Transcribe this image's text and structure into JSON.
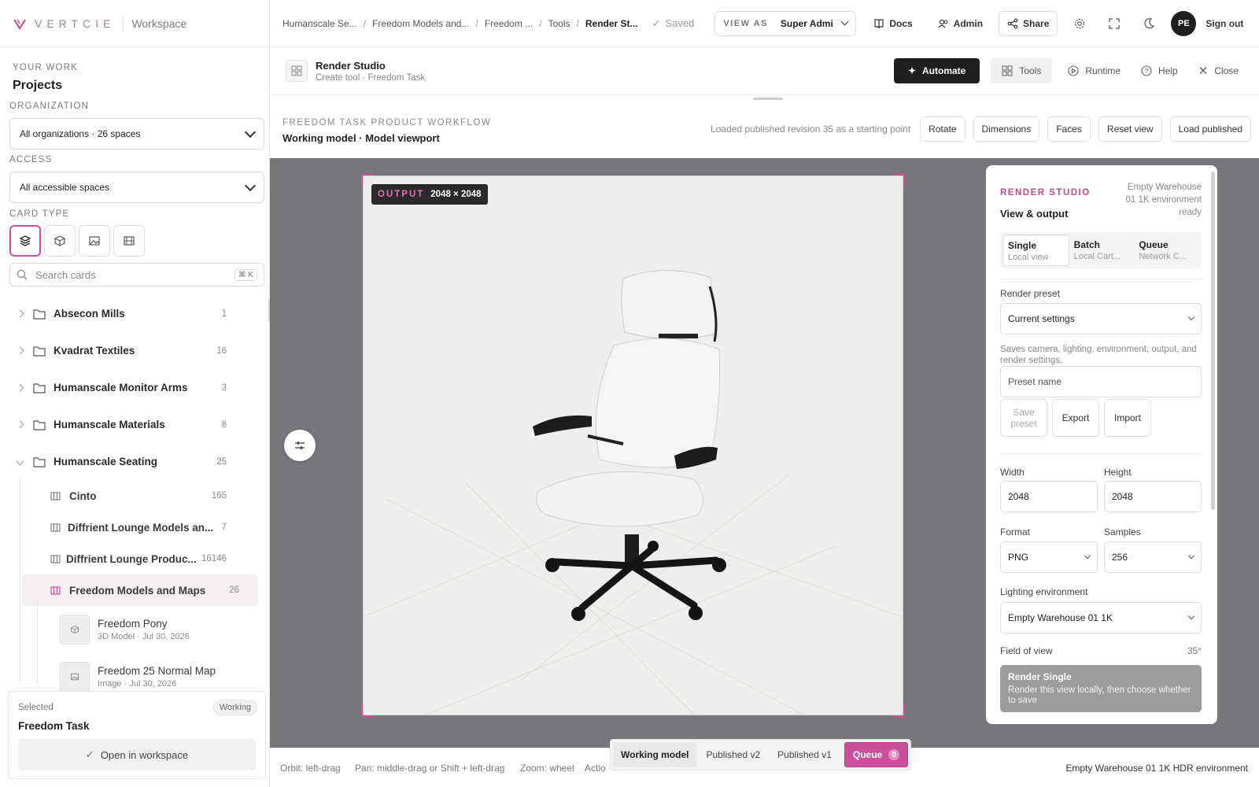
{
  "brand": {
    "logo_text": "VERTCIE",
    "workspace": "Workspace"
  },
  "sidebar": {
    "your_work": "YOUR WORK",
    "title": "Projects",
    "org_label": "ORGANIZATION",
    "org_value": "All organizations · 26 spaces",
    "access_label": "ACCESS",
    "access_value": "All accessible spaces",
    "card_type_label": "CARD TYPE",
    "card_types": [
      "layers-icon",
      "cube-icon",
      "image-icon",
      "film-icon"
    ],
    "search_placeholder": "Search cards",
    "search_shortcut": "⌘ K",
    "folders": [
      {
        "name": "Absecon Mills",
        "count": "1"
      },
      {
        "name": "Kvadrat Textiles",
        "count": "16"
      },
      {
        "name": "Humanscale Monitor Arms",
        "count": "3"
      },
      {
        "name": "Humanscale Materials",
        "count": "8"
      },
      {
        "name": "Humanscale Seating",
        "count": "25"
      }
    ],
    "subfolders": [
      {
        "name": "Cinto",
        "count": "165"
      },
      {
        "name": "Diffrient Lounge Models an...",
        "count": "7"
      },
      {
        "name": "Diffrient Lounge Produc...",
        "count": "16146"
      },
      {
        "name": "Freedom Models and Maps",
        "count": "26"
      }
    ],
    "items": [
      {
        "name": "Freedom Pony",
        "meta": "3D Model · Jul 30, 2026"
      },
      {
        "name": "Freedom 25 Normal Map",
        "meta": "Image · Jul 30, 2026"
      }
    ],
    "selected": {
      "label": "Selected",
      "badge": "Working",
      "name": "Freedom Task",
      "open_label": "Open in workspace"
    }
  },
  "topbar": {
    "breadcrumbs": [
      "Humanscale Se...",
      "Freedom Models and...",
      "Freedom ...",
      "Tools",
      "Render St..."
    ],
    "saved": "Saved",
    "view_as_label": "VIEW AS",
    "view_as_value": "Super Admi",
    "docs": "Docs",
    "admin": "Admin",
    "share": "Share",
    "avatar": "PE",
    "sign_out": "Sign out"
  },
  "tool": {
    "name": "Render Studio",
    "sub": "Create tool · Freedom Task",
    "automate": "Automate",
    "tools": "Tools",
    "runtime": "Runtime",
    "help": "Help",
    "close": "Close"
  },
  "workflow": {
    "kicker": "FREEDOM TASK PRODUCT WORKFLOW",
    "title": "Working model · Model viewport",
    "note": "Loaded published revision 35 as a starting point",
    "buttons": [
      "Rotate",
      "Dimensions",
      "Faces",
      "Reset view",
      "Load published"
    ]
  },
  "viewport": {
    "output_label": "OUTPUT",
    "output_size": "2048 × 2048"
  },
  "render_panel": {
    "kicker": "RENDER STUDIO",
    "title": "View & output",
    "env_status": "Empty Warehouse 01 1K environment ready",
    "modes": [
      {
        "title": "Single",
        "sub": "Local view"
      },
      {
        "title": "Batch",
        "sub": "Local Cart..."
      },
      {
        "title": "Queue",
        "sub": "Network C..."
      }
    ],
    "preset_label": "Render preset",
    "preset_value": "Current settings",
    "preset_help": "Saves camera, lighting, environment, output, and render settings.",
    "preset_name_placeholder": "Preset name",
    "save_preset": "Save preset",
    "export": "Export",
    "import": "Import",
    "width_label": "Width",
    "width_value": "2048",
    "height_label": "Height",
    "height_value": "2048",
    "format_label": "Format",
    "format_value": "PNG",
    "samples_label": "Samples",
    "samples_value": "256",
    "lighting_label": "Lighting environment",
    "lighting_value": "Empty Warehouse 01 1K",
    "fov_label": "Field of view",
    "fov_value": "35°",
    "render_title": "Render Single",
    "render_sub": "Render this view locally, then choose whether to save"
  },
  "bottombar": {
    "orbit": "Orbit: left-drag",
    "pan": "Pan: middle-drag or Shift + left-drag",
    "zoom": "Zoom: wheel",
    "actions": "Actio",
    "tabs": [
      "Working model",
      "Published v2",
      "Published v1"
    ],
    "queue": "Queue",
    "queue_count": "0",
    "env": "Empty Warehouse 01 1K HDR environment"
  },
  "colors": {
    "accent": "#cc4f9e",
    "dark": "#1f1f1f",
    "viewport_bg": "#77777b"
  }
}
